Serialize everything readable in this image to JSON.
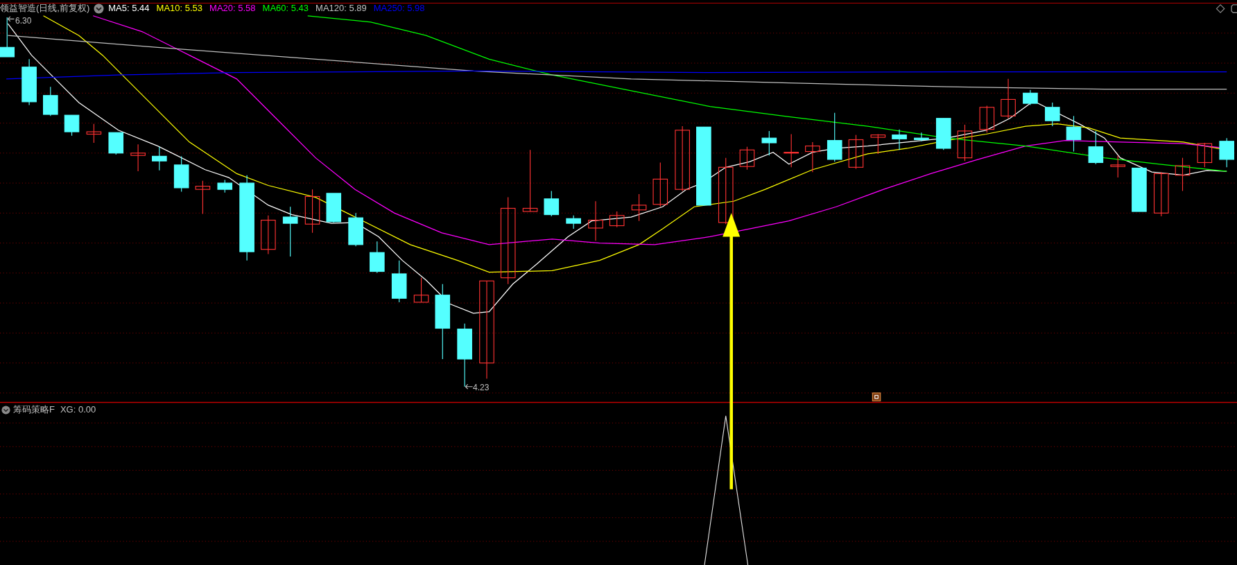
{
  "main_panel": {
    "title": "领益智造(日线,前复权)",
    "indicators": [
      {
        "label": "MA5: 5.44",
        "color": "#ffffff"
      },
      {
        "label": "MA10: 5.53",
        "color": "#ffff00"
      },
      {
        "label": "MA20: 5.58",
        "color": "#ff00ff"
      },
      {
        "label": "MA60: 5.43",
        "color": "#00ff00"
      },
      {
        "label": "MA120: 5.89",
        "color": "#c0c0c0"
      },
      {
        "label": "MA250: 5.98",
        "color": "#0000ff"
      }
    ],
    "high_label": "6.30",
    "low_label": "4.23"
  },
  "sub_panel": {
    "title": "筹码策略F",
    "reading": "XG: 0.00"
  }
}
